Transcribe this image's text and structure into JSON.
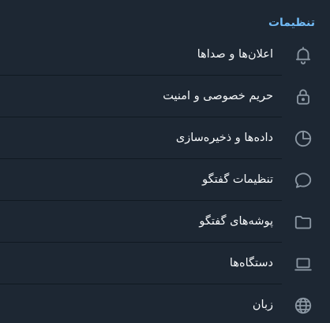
{
  "settings": {
    "title": "تنظیمات",
    "items": [
      {
        "label": "اعلان‌ها و صداها",
        "icon": "bell-icon"
      },
      {
        "label": "حریم خصوصی و امنیت",
        "icon": "lock-icon"
      },
      {
        "label": "داده‌ها و ذخیره‌سازی",
        "icon": "pie-chart-icon"
      },
      {
        "label": "تنظیمات گفتگو",
        "icon": "chat-bubble-icon"
      },
      {
        "label": "پوشه‌های گفتگو",
        "icon": "folder-icon"
      },
      {
        "label": "دستگاه‌ها",
        "icon": "laptop-icon"
      },
      {
        "label": "زبان",
        "icon": "globe-icon"
      }
    ]
  },
  "colors": {
    "background": "#1d2733",
    "accent": "#71baf5",
    "text": "#f5f7f9",
    "icon": "#8b97a3",
    "divider": "#101921"
  }
}
